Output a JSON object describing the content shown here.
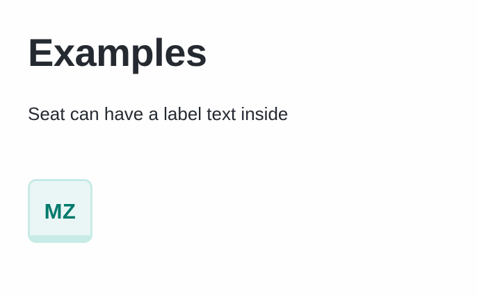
{
  "heading": {
    "title": "Examples",
    "description": "Seat can have a label text inside"
  },
  "seat": {
    "label": "MZ",
    "colors": {
      "background": "#eaf6f5",
      "border": "#c7ebe6",
      "text": "#007a6b"
    }
  }
}
